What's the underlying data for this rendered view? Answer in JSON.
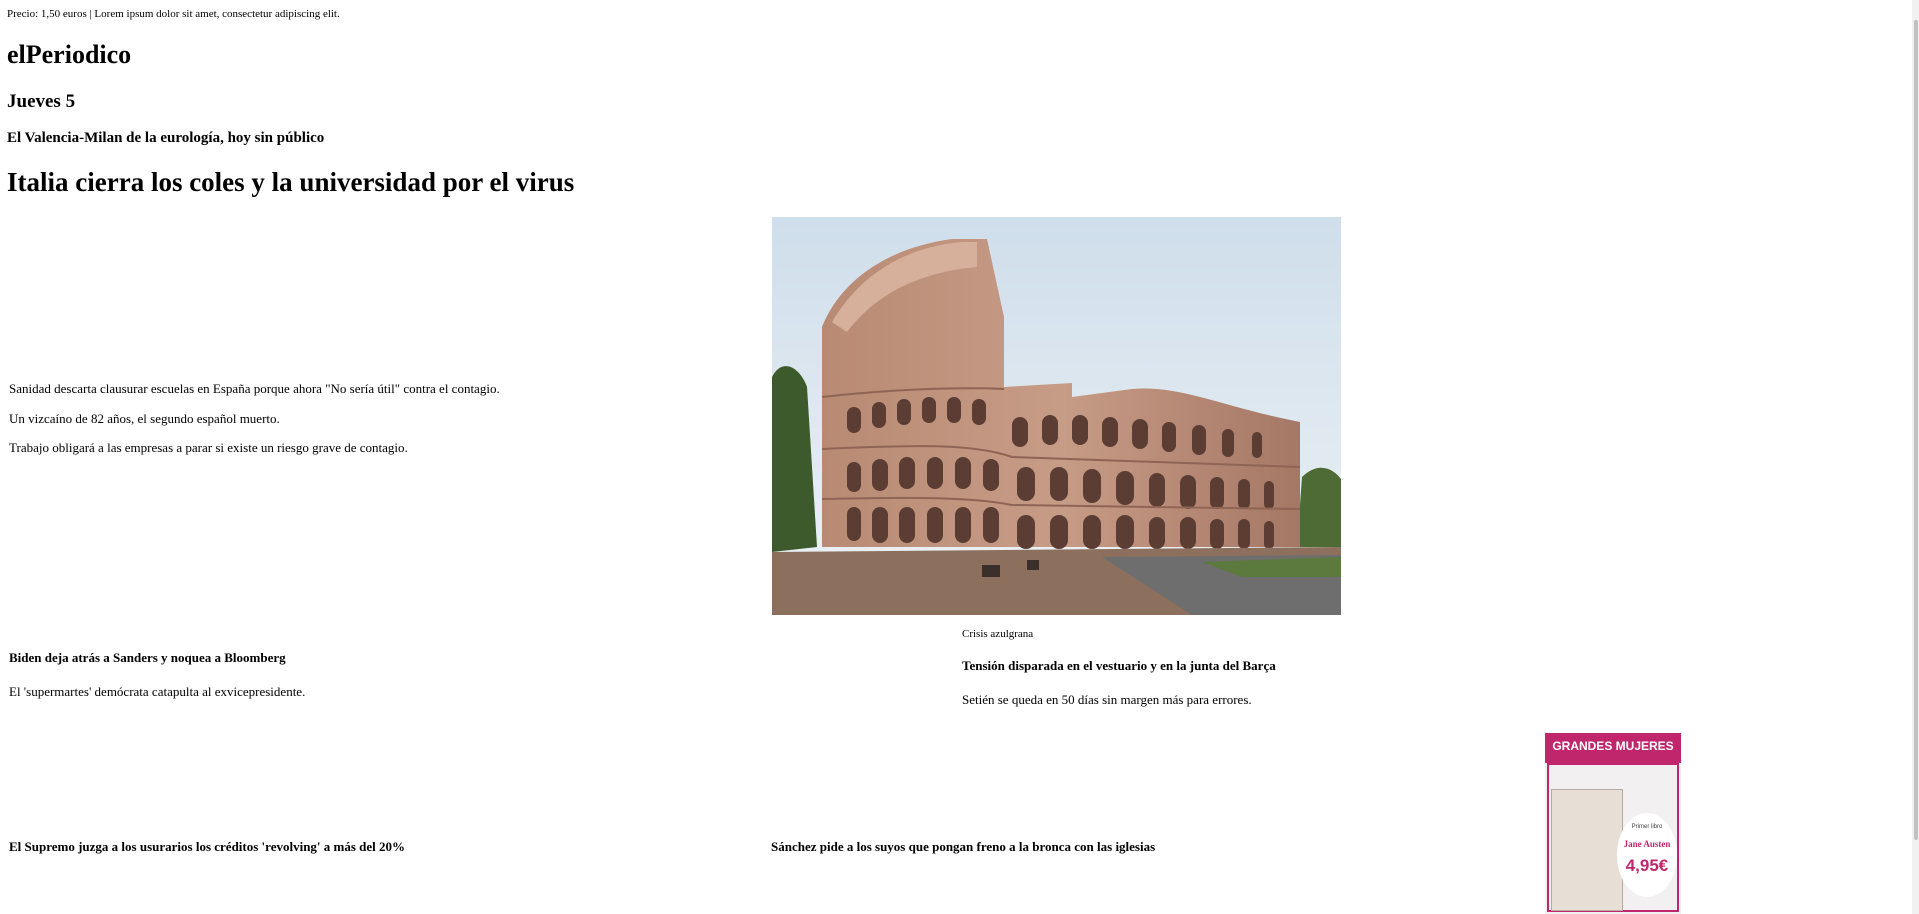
{
  "header": {
    "topline": "Precio: 1,50 euros | Lorem ipsum dolor sit amet, consectetur adipiscing elit.",
    "brand": "elPeriodico",
    "day": "Jueves 5"
  },
  "lead": {
    "kicker": "El Valencia-Milan de la eurología, hoy sin público",
    "headline": "Italia cierra los coles y la universidad por el virus",
    "subs": [
      "Sanidad descarta clausurar escuelas en España porque ahora \"No sería útil\" contra el contagio.",
      "Un vizcaíno de 82 años, el segundo español muerto.",
      "Trabajo obligará a las empresas a parar si existe un riesgo grave de contagio."
    ]
  },
  "photo": {
    "icon": "colosseum-photo",
    "caption": "Crisis azulgrana"
  },
  "stories": {
    "biden": {
      "title": "Biden deja atrás a Sanders y noquea a Bloomberg",
      "text": "El 'supermartes' demócrata catapulta al exvicepresidente."
    },
    "barca": {
      "title": "Tensión disparada en el vestuario y en la junta del Barça",
      "text": "Setién se queda en 50 días sin margen más para errores."
    },
    "supremo": {
      "title": "El Supremo juzga a los usurarios los créditos 'revolving' a más del 20%"
    },
    "sanchez": {
      "title": "Sánchez pide a los suyos que pongan freno a la bronca con las iglesias"
    }
  },
  "ad": {
    "title": "GRANDES MUJERES",
    "promo": "Primer libro",
    "author": "Jane Austen",
    "price": "4,95€",
    "accent": "#c0266b"
  }
}
